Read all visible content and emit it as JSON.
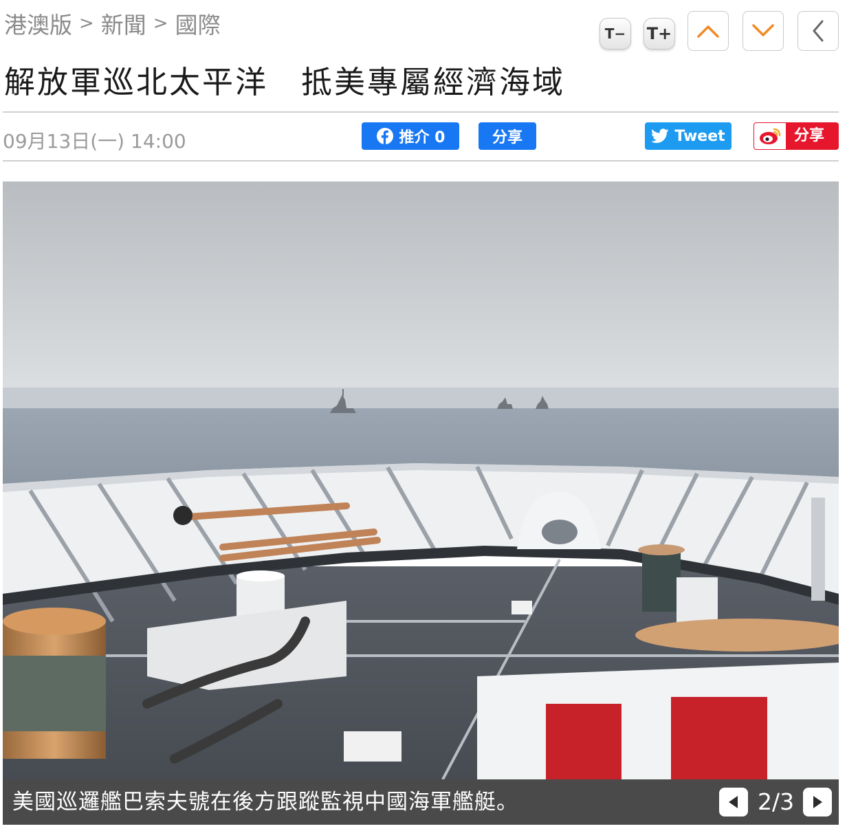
{
  "breadcrumb": [
    "港澳版",
    "新聞",
    "國際"
  ],
  "breadcrumb_separator": ">",
  "toolbar": {
    "font_decrease": "T−",
    "font_increase": "T+",
    "icons": [
      "chevron-up-icon",
      "chevron-down-icon",
      "chevron-left-icon"
    ],
    "accent_color": "#f08a24"
  },
  "article": {
    "title": "解放軍巡北太平洋　抵美專屬經濟海域",
    "date": "09月13日(一) 14:00"
  },
  "share": {
    "facebook_like": "推介 0",
    "facebook_share": "分享",
    "twitter": "Tweet",
    "weibo": "分享",
    "colors": {
      "facebook": "#1877f2",
      "twitter": "#1d9bf0",
      "weibo": "#e6162d"
    }
  },
  "gallery": {
    "caption": "美國巡邏艦巴索夫號在後方跟蹤監視中國海軍艦艇。",
    "counter": "2/3"
  }
}
